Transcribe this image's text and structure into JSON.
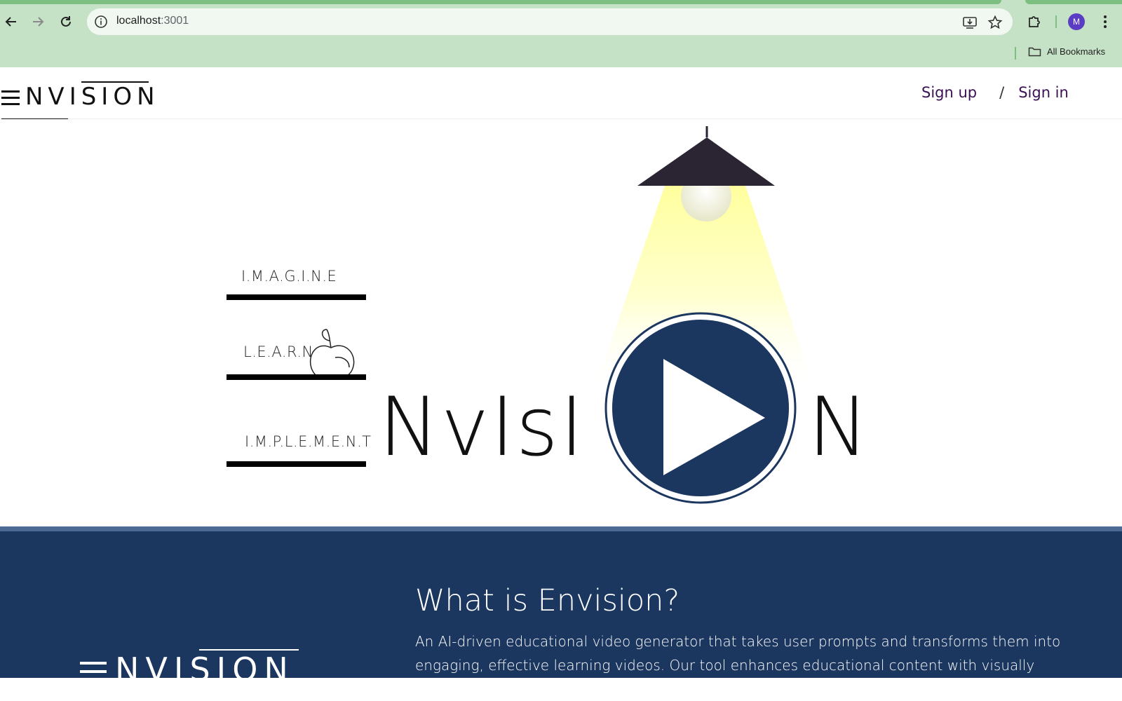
{
  "browser": {
    "url_host": "localhost",
    "url_port": ":3001",
    "profile_initial": "M",
    "bookmarks_label": "All Bookmarks"
  },
  "header": {
    "logo_text": "NVISION",
    "sign_up": "Sign up",
    "separator": "/",
    "sign_in": "Sign in"
  },
  "hero": {
    "words": [
      "I.M.A.G.I.N.E",
      "L.E.A.R.N",
      "I.M.P.L.E.M.E.N.T"
    ],
    "title_left": "NvIsI",
    "title_right": "N"
  },
  "info": {
    "title": "What is Envision?",
    "body": "An AI-driven educational video generator that takes user prompts and transforms them into engaging, effective learning videos. Our tool enhances educational content with visually captivating elements to boost student clarity and retention.",
    "logo_text": "NVISION"
  },
  "colors": {
    "chrome_bg": "#c6e2c6",
    "brand_navy": "#1b365f",
    "auth_link": "#3b1053",
    "lamp_shade": "#2b2433",
    "light_beam": "#ffffb0"
  }
}
